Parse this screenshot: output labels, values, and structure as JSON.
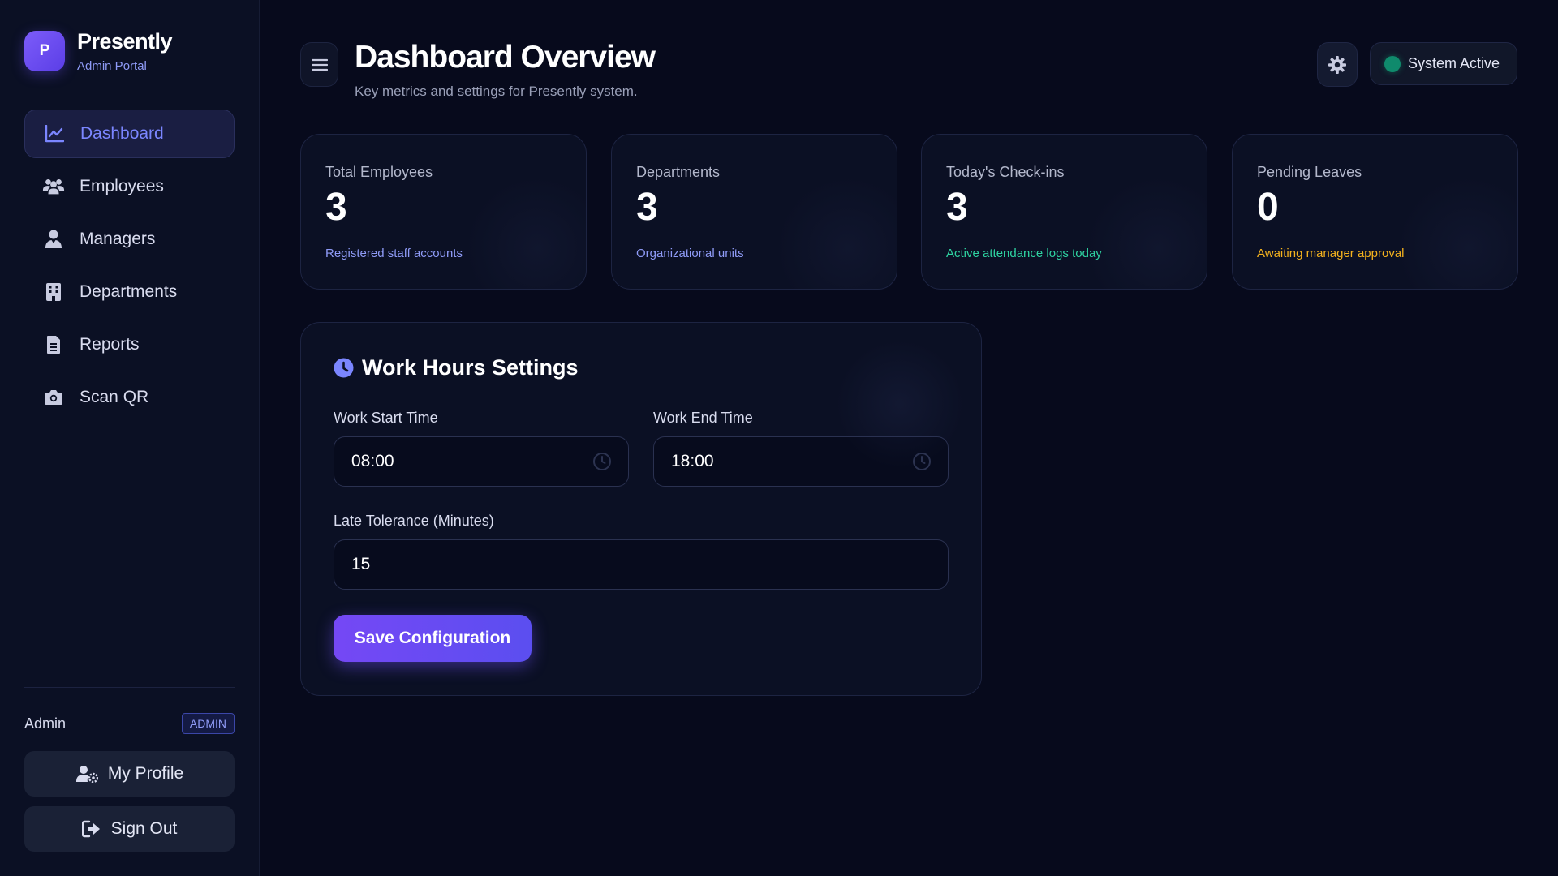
{
  "brand": {
    "logo_letter": "P",
    "name": "Presently",
    "subtitle": "Admin Portal"
  },
  "sidebar": {
    "items": [
      {
        "label": "Dashboard",
        "icon": "chart-line-icon",
        "active": true
      },
      {
        "label": "Employees",
        "icon": "users-icon"
      },
      {
        "label": "Managers",
        "icon": "user-tie-icon"
      },
      {
        "label": "Departments",
        "icon": "building-icon"
      },
      {
        "label": "Reports",
        "icon": "file-lines-icon"
      },
      {
        "label": "Scan QR",
        "icon": "camera-icon"
      }
    ],
    "user": {
      "name": "Admin",
      "role_badge": "ADMIN"
    },
    "profile_button": "My Profile",
    "signout_button": "Sign Out"
  },
  "header": {
    "title": "Dashboard Overview",
    "subtitle": "Key metrics and settings for Presently system.",
    "status": "System Active"
  },
  "stats": [
    {
      "label": "Total Employees",
      "value": "3",
      "note": "Registered staff accounts",
      "note_color": "#8f9bf7"
    },
    {
      "label": "Departments",
      "value": "3",
      "note": "Organizational units",
      "note_color": "#8f9bf7"
    },
    {
      "label": "Today's Check-ins",
      "value": "3",
      "note": "Active attendance logs today",
      "note_color": "#2ed3a1"
    },
    {
      "label": "Pending Leaves",
      "value": "0",
      "note": "Awaiting manager approval",
      "note_color": "#f5b31e"
    }
  ],
  "settings": {
    "title": "Work Hours Settings",
    "start_label": "Work Start Time",
    "start_value": "08:00",
    "end_label": "Work End Time",
    "end_value": "18:00",
    "tolerance_label": "Late Tolerance (Minutes)",
    "tolerance_value": "15",
    "save_button": "Save Configuration"
  },
  "colors": {
    "accent": "#7b86ff",
    "brand": "#6a4cf5",
    "background": "#070a1c",
    "status_green": "#0f8a6c"
  }
}
